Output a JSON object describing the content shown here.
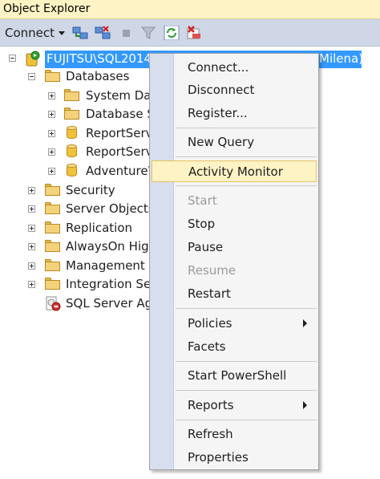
{
  "panel": {
    "title": "Object Explorer"
  },
  "toolbar": {
    "connect_label": "Connect",
    "icons": [
      "connect-object-explorer-icon",
      "disconnect-icon",
      "stop-icon",
      "filter-icon",
      "refresh-icon",
      "remove-icon"
    ]
  },
  "tree": {
    "server": {
      "label": "FUJITSU\\SQL2014",
      "label_tail": "Milena)"
    },
    "items": [
      {
        "label": "Databases"
      },
      {
        "label": "System Dat"
      },
      {
        "label": "Database Sr"
      },
      {
        "label": "ReportServe"
      },
      {
        "label": "ReportServe"
      },
      {
        "label": "AdventureW"
      },
      {
        "label": "Security"
      },
      {
        "label": "Server Objects"
      },
      {
        "label": "Replication"
      },
      {
        "label": "AlwaysOn High"
      },
      {
        "label": "Management"
      },
      {
        "label": "Integration Serv"
      },
      {
        "label": "SQL Server Age"
      }
    ]
  },
  "context_menu": {
    "items": [
      {
        "label": "Connect..."
      },
      {
        "label": "Disconnect"
      },
      {
        "label": "Register..."
      },
      {
        "label": "New Query"
      },
      {
        "label": "Activity Monitor"
      },
      {
        "label": "Start"
      },
      {
        "label": "Stop"
      },
      {
        "label": "Pause"
      },
      {
        "label": "Resume"
      },
      {
        "label": "Restart"
      },
      {
        "label": "Policies"
      },
      {
        "label": "Facets"
      },
      {
        "label": "Start PowerShell"
      },
      {
        "label": "Reports"
      },
      {
        "label": "Refresh"
      },
      {
        "label": "Properties"
      }
    ]
  },
  "colors": {
    "selection": "#3399ff",
    "highlight": "#fdf3c4",
    "gutter": "#d7dfee"
  }
}
